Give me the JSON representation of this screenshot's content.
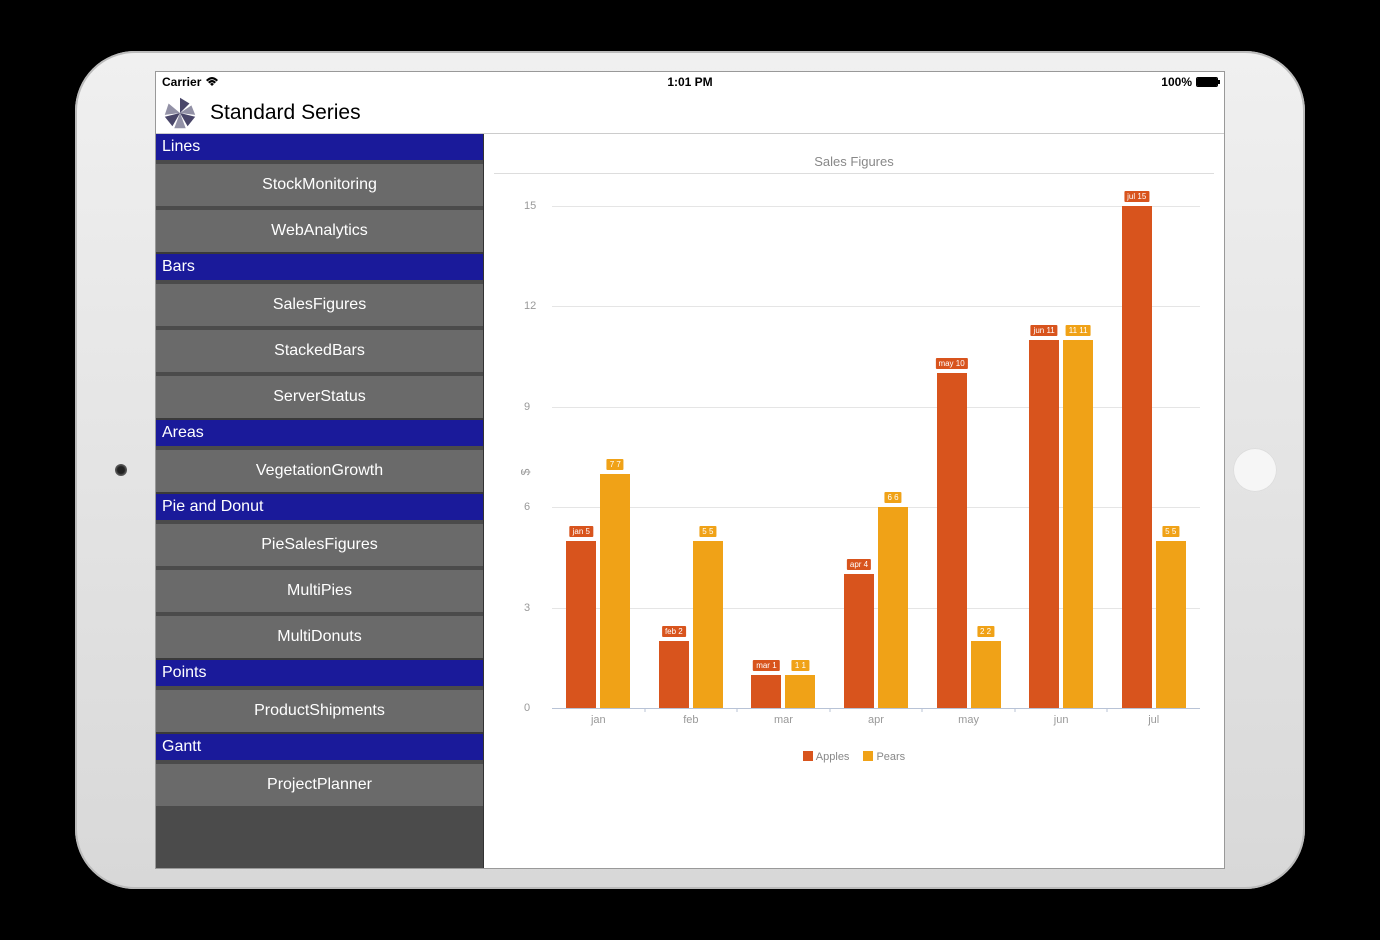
{
  "status": {
    "carrier": "Carrier",
    "time": "1:01 PM",
    "battery": "100%",
    "battery_fill": 100
  },
  "header": {
    "title": "Standard Series"
  },
  "sidebar": [
    {
      "header": "Lines",
      "items": [
        "StockMonitoring",
        "WebAnalytics"
      ]
    },
    {
      "header": "Bars",
      "items": [
        "SalesFigures",
        "StackedBars",
        "ServerStatus"
      ]
    },
    {
      "header": "Areas",
      "items": [
        "VegetationGrowth"
      ]
    },
    {
      "header": "Pie and Donut",
      "items": [
        "PieSalesFigures",
        "MultiPies",
        "MultiDonuts"
      ]
    },
    {
      "header": "Points",
      "items": [
        "ProductShipments"
      ]
    },
    {
      "header": "Gantt",
      "items": [
        "ProjectPlanner"
      ]
    }
  ],
  "chart_data": {
    "type": "bar",
    "title": "Sales Figures",
    "xlabel": "",
    "ylabel": "$",
    "ylim": [
      0,
      15
    ],
    "yticks": [
      0,
      3,
      6,
      9,
      12,
      15
    ],
    "categories": [
      "jan",
      "feb",
      "mar",
      "apr",
      "may",
      "jun",
      "jul"
    ],
    "series": [
      {
        "name": "Apples",
        "values": [
          5,
          2,
          1,
          4,
          10,
          11,
          15
        ],
        "labels": [
          "jan 5",
          "feb 2",
          "mar 1",
          "apr 4",
          "may 10",
          "jun 11",
          "jul 15"
        ]
      },
      {
        "name": "Pears",
        "values": [
          7,
          5,
          1,
          6,
          2,
          11,
          5
        ],
        "labels": [
          "7 7",
          "5 5",
          "1 1",
          "6 6",
          "2 2",
          "11 11",
          "5 5"
        ]
      }
    ],
    "colors": {
      "Apples": "#d8541d",
      "Pears": "#f0a217"
    }
  }
}
